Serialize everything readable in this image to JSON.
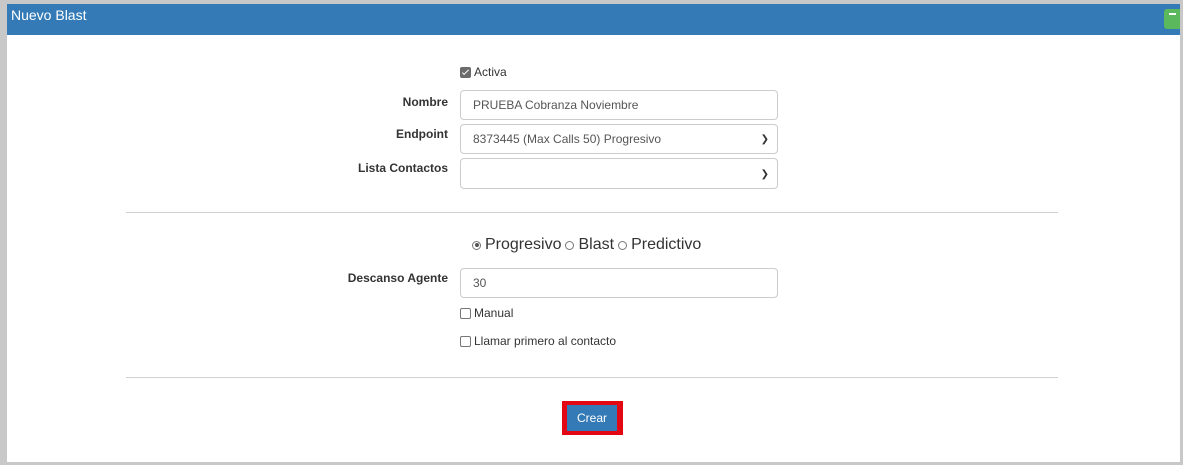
{
  "panel": {
    "title": "Nuevo Blast"
  },
  "form": {
    "activa_label": "Activa",
    "activa_checked": true,
    "nombre_label": "Nombre",
    "nombre_value": "PRUEBA Cobranza Noviembre",
    "endpoint_label": "Endpoint",
    "endpoint_value": "8373445 (Max Calls 50) Progresivo",
    "lista_label": "Lista Contactos",
    "lista_value": "",
    "mode_options": [
      "Progresivo",
      "Blast",
      "Predictivo"
    ],
    "mode_selected": "Progresivo",
    "descanso_label": "Descanso Agente",
    "descanso_value": "30",
    "manual_label": "Manual",
    "manual_checked": false,
    "llamar_label": "Llamar primero al contacto",
    "llamar_checked": false,
    "submit_label": "Crear"
  },
  "colors": {
    "header": "#337ab7",
    "highlight": "#e30613",
    "collapse": "#5cb85c"
  }
}
